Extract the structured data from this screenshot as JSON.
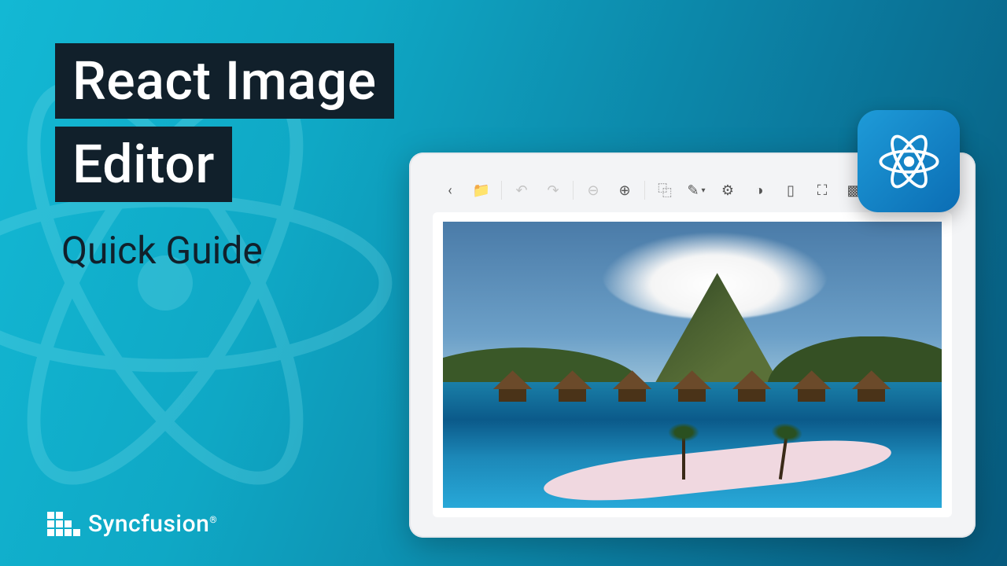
{
  "title": {
    "line1": "React Image",
    "line2": "Editor"
  },
  "subtitle": "Quick Guide",
  "brand": "Syncfusion",
  "badge": {
    "icon": "react-logo-icon"
  },
  "editor": {
    "toolbar": [
      {
        "name": "back-icon",
        "glyph": "‹",
        "interact": true,
        "disabled": false
      },
      {
        "name": "open-icon",
        "glyph": "📁",
        "interact": true,
        "disabled": false,
        "style": "outline"
      },
      {
        "sep": true
      },
      {
        "name": "undo-icon",
        "glyph": "↶",
        "interact": false,
        "disabled": true
      },
      {
        "name": "redo-icon",
        "glyph": "↷",
        "interact": false,
        "disabled": true
      },
      {
        "sep": true
      },
      {
        "name": "zoom-out-icon",
        "glyph": "⊖",
        "interact": false,
        "disabled": true
      },
      {
        "name": "zoom-in-icon",
        "glyph": "⊕",
        "interact": true,
        "disabled": false
      },
      {
        "sep": true
      },
      {
        "name": "crop-icon",
        "glyph": "⿻",
        "interact": true,
        "disabled": false
      },
      {
        "name": "annotate-icon",
        "glyph": "✎",
        "interact": true,
        "disabled": false,
        "caret": true
      },
      {
        "name": "finetune-icon",
        "glyph": "⚙",
        "interact": true,
        "disabled": false,
        "alt": "☰"
      },
      {
        "name": "filter-icon",
        "glyph": "◑",
        "interact": true,
        "disabled": false
      },
      {
        "name": "frame-icon",
        "glyph": "▯",
        "interact": true,
        "disabled": false
      },
      {
        "name": "resize-icon",
        "glyph": "⛶",
        "interact": true,
        "disabled": false
      },
      {
        "name": "redact-icon",
        "glyph": "▩",
        "interact": true,
        "disabled": false
      },
      {
        "name": "reset-icon",
        "glyph": "↻",
        "interact": true,
        "disabled": false
      }
    ],
    "image_alt": "Tropical island with mountain, overwater huts and lagoon"
  }
}
